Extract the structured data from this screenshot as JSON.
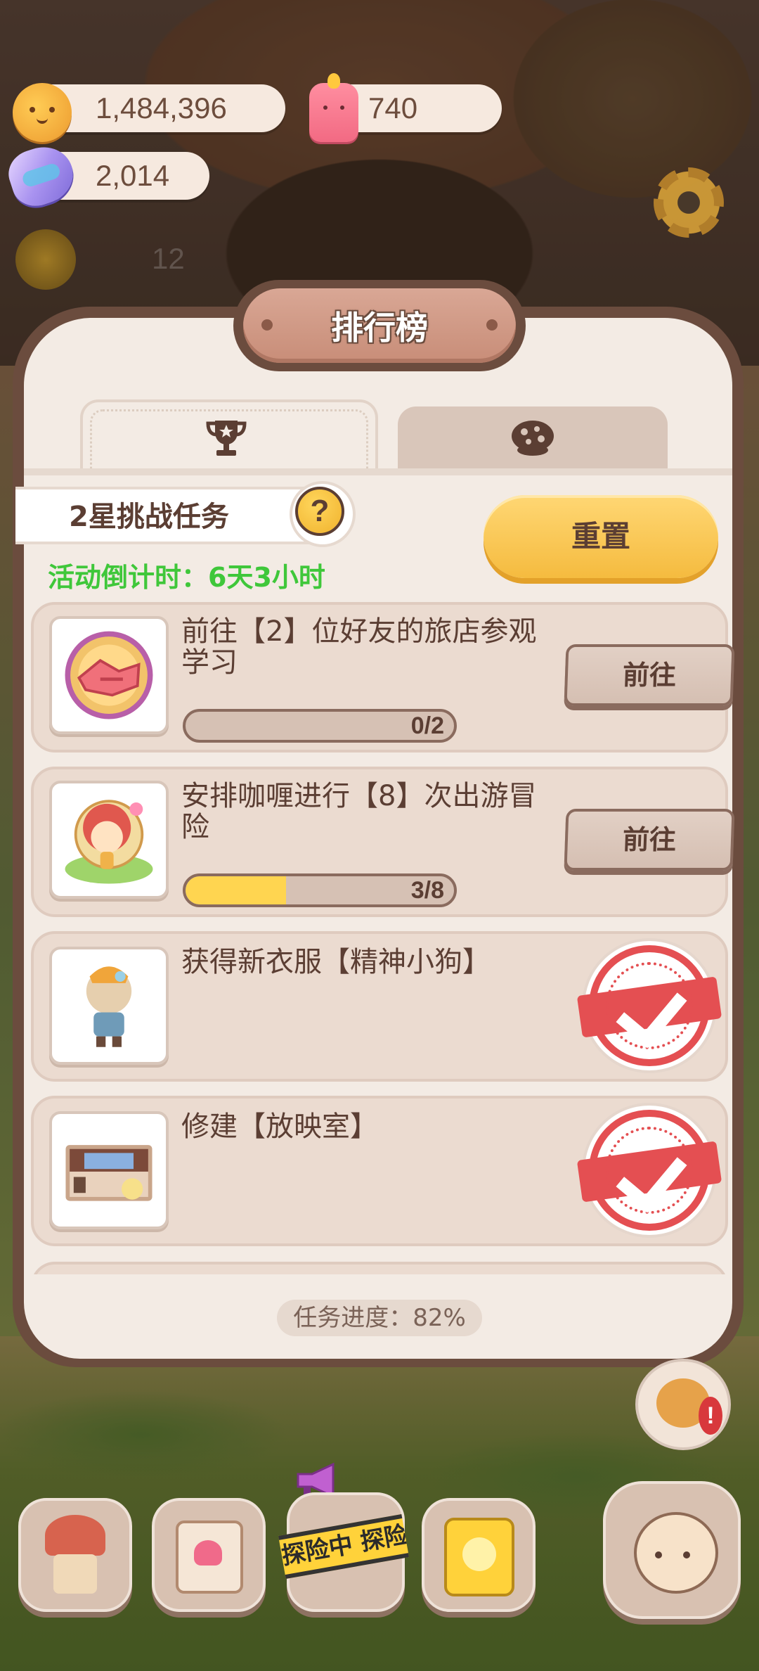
{
  "resources": {
    "cookies": "1,484,396",
    "candles": "740",
    "gems": "2,014",
    "background_count": "12"
  },
  "panel": {
    "title": "排行榜",
    "tabs": [
      {
        "icon": "trophy-icon",
        "selected": true
      },
      {
        "icon": "cookie-icon",
        "selected": false
      }
    ],
    "mission_label": "2星挑战任务",
    "help_label": "?",
    "countdown": "活动倒计时：6天3小时",
    "reset_label": "重置",
    "tasks": [
      {
        "title": "前往【2】位好友的旅店参观学习",
        "progress_text": "0/2",
        "progress": 0,
        "action": "前往",
        "completed": false
      },
      {
        "title": "安排咖喱进行【8】次出游冒险",
        "progress_text": "3/8",
        "progress": 0.375,
        "action": "前往",
        "completed": false
      },
      {
        "title": "获得新衣服【精神小狗】",
        "completed": true
      },
      {
        "title": "修建【放映室】",
        "completed": true
      }
    ],
    "overall_progress": "任务进度：82%"
  },
  "nav": {
    "explore_label": "探险中 探险"
  },
  "colors": {
    "panel_bg": "#f3ebe4",
    "panel_border": "#6b4c3e",
    "accent_yellow": "#f5bb3f",
    "countdown_green": "#3fc73a",
    "stamp_red": "#e44f52",
    "progress_fill": "#ffd550"
  }
}
